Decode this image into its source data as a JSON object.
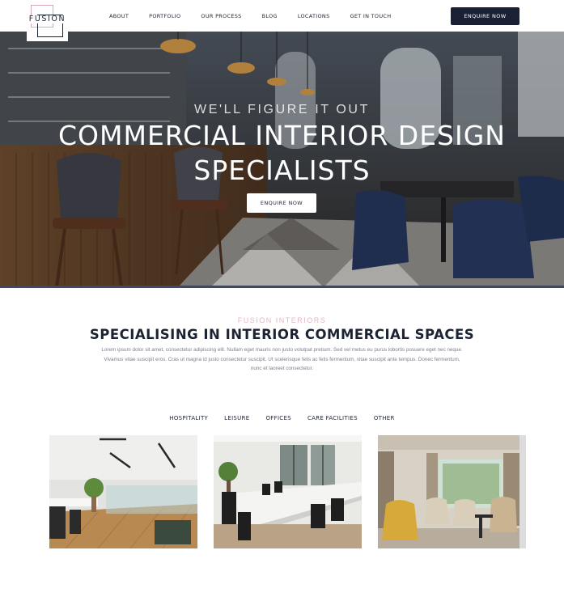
{
  "header": {
    "logo_text": "FUSION",
    "nav": [
      "ABOUT",
      "PORTFOLIO",
      "OUR PROCESS",
      "BLOG",
      "LOCATIONS",
      "GET IN TOUCH"
    ],
    "cta_label": "ENQUIRE NOW"
  },
  "hero": {
    "kicker": "WE'LL FIGURE IT OUT",
    "title": "COMMERCIAL INTERIOR DESIGN SPECIALISTS",
    "cta_label": "ENQUIRE NOW"
  },
  "intro": {
    "eyebrow": "FUSION INTERIORS",
    "title": "SPECIALISING IN INTERIOR COMMERCIAL SPACES",
    "body": "Lorem ipsum dolor sit amet, consectetur adipiscing elit. Nullam eget mauris non justo volutpat pretium. Sed vel metus eu purus lobortis posuere eget nec neque. Vivamus vitae suscipit eros. Cras ut magna id justo consectetur suscipit. Ut scelerisque felis ac felis fermentum, vitae suscipit ante tempus. Donec fermentum, nunc et laoreet consectetur."
  },
  "tabs": [
    "HOSPITALITY",
    "LEISURE",
    "OFFICES",
    "CARE FACILITIES",
    "OTHER"
  ],
  "colors": {
    "navy": "#1b2134",
    "pink_accent": "#e4b8c6",
    "hero_line": "#3c4a68"
  }
}
